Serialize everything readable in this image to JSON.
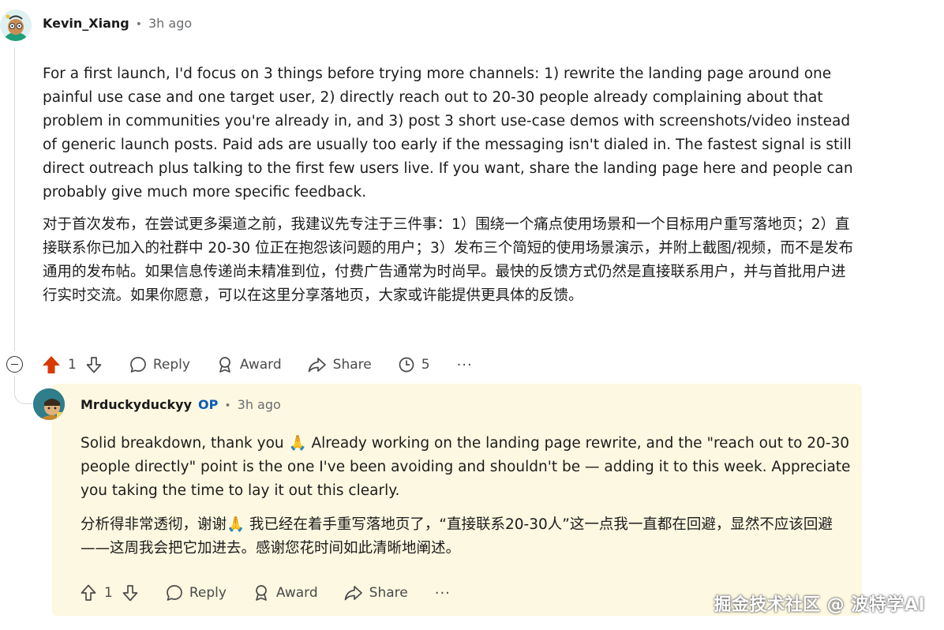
{
  "comment": {
    "username": "Kevin_Xiang",
    "time": "3h ago",
    "body_en": "For a first launch, I'd focus on 3 things before trying more channels: 1) rewrite the landing page around one painful use case and one target user, 2) directly reach out to 20-30 people already complaining about that problem in communities you're already in, and 3) post 3 short use-case demos with screenshots/video instead of generic launch posts. Paid ads are usually too early if the messaging isn't dialed in. The fastest signal is still direct outreach plus talking to the first few users live. If you want, share the landing page here and people can probably give much more specific feedback.",
    "body_cn": "对于首次发布，在尝试更多渠道之前，我建议先专注于三件事：1）围绕一个痛点使用场景和一个目标用户重写落地页；2）直接联系你已加入的社群中 20-30 位正在抱怨该问题的用户；3）发布三个简短的使用场景演示，并附上截图/视频，而不是发布通用的发布帖。如果信息传递尚未精准到位，付费广告通常为时尚早。最快的反馈方式仍然是直接联系用户，并与首批用户进行实时交流。如果你愿意，可以在这里分享落地页，大家或许能提供更具体的反馈。",
    "actions": {
      "upvotes": "1",
      "reply": "Reply",
      "award": "Award",
      "share": "Share",
      "reply_count": "5",
      "more": "···"
    }
  },
  "reply": {
    "username": "Mrduckyduckyy",
    "op_badge": "OP",
    "time": "3h ago",
    "body_en_1": "Solid breakdown, thank you 🙏 Already working on the landing page rewrite, and the \"reach out to 20-30 people directly\" point is the one I've been avoiding and shouldn't be — adding it to this week. Appreciate you taking the time to lay it out this clearly.",
    "body_cn": "分析得非常透彻，谢谢🙏 我已经在着手重写落地页了，“直接联系20-30人”这一点我一直都在回避，显然不应该回避——这周我会把它加进去。感谢您花时间如此清晰地阐述。",
    "actions": {
      "upvotes": "1",
      "reply": "Reply",
      "award": "Award",
      "share": "Share",
      "more": "···"
    }
  },
  "watermark": "掘金技术社区 @ 波特学AI",
  "colors": {
    "upvote_active": "#d93a00",
    "reply_highlight": "#fdf8e1",
    "op_blue": "#0a5bb5"
  }
}
